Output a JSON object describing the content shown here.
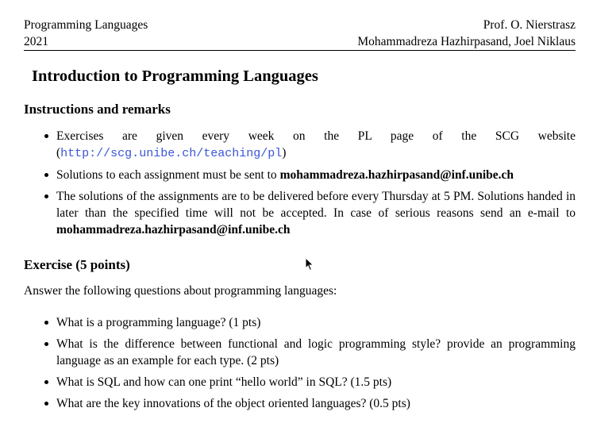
{
  "header": {
    "course": "Programming Languages",
    "year": "2021",
    "professor": "Prof. O. Nierstrasz",
    "assistants": "Mohammadreza Hazhirpasand, Joel Niklaus"
  },
  "title": "Introduction to Programming Languages",
  "instructions": {
    "heading": "Instructions and remarks",
    "items": [
      {
        "before": "Exercises are given every week on the PL page of the SCG website (",
        "link": "http://scg.unibe.ch/teaching/pl",
        "after": ")"
      },
      {
        "before": "Solutions to each assignment must be sent to ",
        "email": "mohammadreza.hazhirpasand@inf.unibe.ch"
      },
      {
        "before": "The solutions of the assignments are to be delivered before every Thursday at 5 PM. Solutions handed in later than the specified time will not be accepted.  In case of serious reasons send an e-mail to ",
        "email": "mohammadreza.hazhirpasand@inf.unibe.ch"
      }
    ]
  },
  "exercise": {
    "heading": "Exercise (5 points)",
    "intro": "Answer the following questions about programming languages:",
    "questions": [
      "What is a programming language? (1 pts)",
      "What is the difference between functional and logic programming style? provide an programming language as an example for each type. (2 pts)",
      "What is SQL and how can one print “hello world” in SQL? (1.5 pts)",
      "What are the key innovations of the object oriented languages? (0.5 pts)"
    ]
  }
}
